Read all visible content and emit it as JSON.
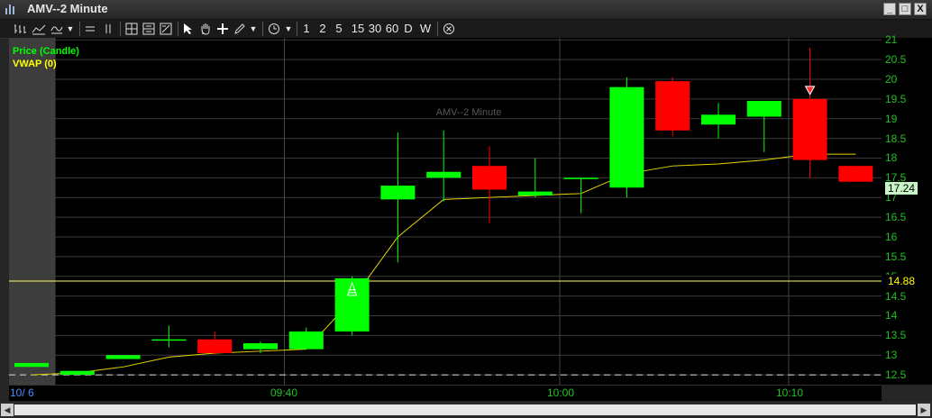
{
  "window": {
    "title": "AMV--2 Minute",
    "buttons": [
      "_",
      "□",
      "X"
    ]
  },
  "toolbar": {
    "intervals": [
      "1",
      "2",
      "5",
      "15",
      "30",
      "60",
      "D",
      "W"
    ]
  },
  "legend": {
    "price": "Price (Candle)",
    "vwap": "VWAP (0)",
    "price_color": "#00ff00",
    "vwap_color": "#ffff00"
  },
  "watermark": "AMV--2 Minute",
  "price_tags": {
    "last": "17.24",
    "line": "14.88"
  },
  "colors": {
    "up": "#00ff00",
    "down": "#ff0000",
    "vwap": "#e6d800",
    "axis_text": "#20c020",
    "grid": "#3a3a3a"
  },
  "chart_data": {
    "type": "candlestick",
    "title": "AMV--2 Minute",
    "ylim": [
      12.25,
      21.05
    ],
    "y_ticks": [
      12.5,
      13,
      13.5,
      14,
      14.5,
      15,
      15.5,
      16,
      16.5,
      17,
      17.5,
      18,
      18.5,
      19,
      19.5,
      20,
      20.5,
      21
    ],
    "x_ticks": [
      "10/ 6",
      "09:40",
      "10:00",
      "10:10"
    ],
    "candles": [
      {
        "open": 12.7,
        "high": 12.8,
        "low": 12.7,
        "close": 12.8,
        "dir": "up"
      },
      {
        "open": 12.5,
        "high": 12.6,
        "low": 12.5,
        "close": 12.6,
        "dir": "up"
      },
      {
        "open": 12.9,
        "high": 13.0,
        "low": 12.9,
        "close": 13.0,
        "dir": "up"
      },
      {
        "open": 13.4,
        "high": 13.75,
        "low": 13.2,
        "close": 13.4,
        "dir": "up"
      },
      {
        "open": 13.4,
        "high": 13.6,
        "low": 13.0,
        "close": 13.05,
        "dir": "down"
      },
      {
        "open": 13.15,
        "high": 13.35,
        "low": 13.05,
        "close": 13.3,
        "dir": "up"
      },
      {
        "open": 13.15,
        "high": 13.7,
        "low": 13.15,
        "close": 13.6,
        "dir": "up"
      },
      {
        "open": 13.6,
        "high": 15.0,
        "low": 13.5,
        "close": 14.95,
        "dir": "up"
      },
      {
        "open": 16.95,
        "high": 18.65,
        "low": 15.35,
        "close": 17.3,
        "dir": "up"
      },
      {
        "open": 17.5,
        "high": 18.7,
        "low": 16.9,
        "close": 17.65,
        "dir": "up"
      },
      {
        "open": 17.8,
        "high": 18.3,
        "low": 16.35,
        "close": 17.2,
        "dir": "down"
      },
      {
        "open": 17.05,
        "high": 18.0,
        "low": 17.0,
        "close": 17.15,
        "dir": "up"
      },
      {
        "open": 17.5,
        "high": 17.5,
        "low": 16.6,
        "close": 17.5,
        "dir": "up"
      },
      {
        "open": 17.25,
        "high": 20.05,
        "low": 17.0,
        "close": 19.8,
        "dir": "up"
      },
      {
        "open": 19.95,
        "high": 20.05,
        "low": 18.55,
        "close": 18.7,
        "dir": "down"
      },
      {
        "open": 18.85,
        "high": 19.4,
        "low": 18.5,
        "close": 19.1,
        "dir": "up"
      },
      {
        "open": 19.05,
        "high": 19.45,
        "low": 18.15,
        "close": 19.45,
        "dir": "up"
      },
      {
        "open": 19.5,
        "high": 20.8,
        "low": 17.5,
        "close": 17.95,
        "dir": "down"
      },
      {
        "open": 17.8,
        "high": 17.8,
        "low": 17.4,
        "close": 17.4,
        "dir": "down"
      }
    ],
    "vwap": [
      12.5,
      12.55,
      12.7,
      12.95,
      13.05,
      13.1,
      13.15,
      14.4,
      16.0,
      16.95,
      17.0,
      17.05,
      17.1,
      17.6,
      17.8,
      17.85,
      17.95,
      18.1,
      18.1
    ],
    "horizontal_line": 14.88,
    "dashed_line": 12.5,
    "markers": [
      {
        "candle": 7,
        "type": "buy-arrow"
      },
      {
        "candle": 17,
        "type": "sell-arrow"
      }
    ]
  }
}
